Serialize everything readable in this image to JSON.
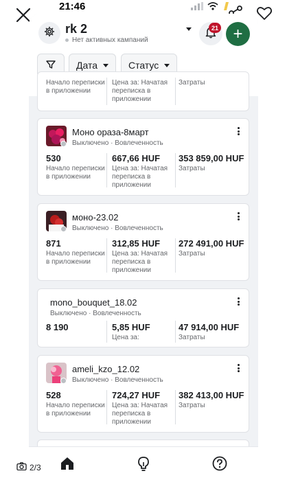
{
  "status_bar": {
    "time": "21:46"
  },
  "viewer": {
    "page_counter": "2/3"
  },
  "account": {
    "name": "rk 2",
    "subtitle": "Нет активных кампаний",
    "notification_count": "21",
    "add_label": "+"
  },
  "filters": {
    "date_label": "Дата",
    "status_label": "Статус"
  },
  "top_card": {
    "m1_label": "Начало переписки в приложении",
    "m2_label": "Цена за: Начатая переписка в приложении",
    "m3_label": "Затраты"
  },
  "campaigns": [
    {
      "name": "Моно ораза-8март",
      "state": "Выключено",
      "delivery": "Вовлеченность",
      "m1_value": "530",
      "m1_label": "Начало переписки в приложении",
      "m2_value": "667,66 HUF",
      "m2_label": "Цена за: Начатая переписка в приложении",
      "m3_value": "353 859,00 HUF",
      "m3_label": "Затраты"
    },
    {
      "name": "моно-23.02",
      "state": "Выключено",
      "delivery": "Вовлеченность",
      "m1_value": "871",
      "m1_label": "Начало переписки в приложении",
      "m2_value": "312,85 HUF",
      "m2_label": "Цена за: Начатая переписка в приложении",
      "m3_value": "272 491,00 HUF",
      "m3_label": "Затраты"
    },
    {
      "name": "mono_bouquet_18.02",
      "state": "Выключено",
      "delivery": "Вовлеченность",
      "m1_value": "8 190",
      "m1_label": "",
      "m2_value": "5,85 HUF",
      "m2_label": "Цена за:",
      "m3_value": "47 914,00 HUF",
      "m3_label": "Затраты"
    },
    {
      "name": "ameli_kzo_12.02",
      "state": "Выключено",
      "delivery": "Вовлеченность",
      "m1_value": "528",
      "m1_label": "Начало переписки в приложении",
      "m2_value": "724,27 HUF",
      "m2_label": "Цена за: Начатая переписка в приложении",
      "m3_value": "382 413,00 HUF",
      "m3_label": "Затраты"
    }
  ],
  "icons": {
    "close": "close-icon",
    "share": "share-icon",
    "heart": "heart-icon",
    "settings": "gear-icon",
    "bell": "bell-icon",
    "filter": "filter-icon",
    "home": "home-icon",
    "tips": "lightbulb-icon",
    "help": "help-icon",
    "camera": "camera-icon",
    "more": "more-vertical-icon"
  },
  "colors": {
    "accent_green": "#1f6e43",
    "badge_red": "#c0142b",
    "background": "#f0f2f5"
  }
}
